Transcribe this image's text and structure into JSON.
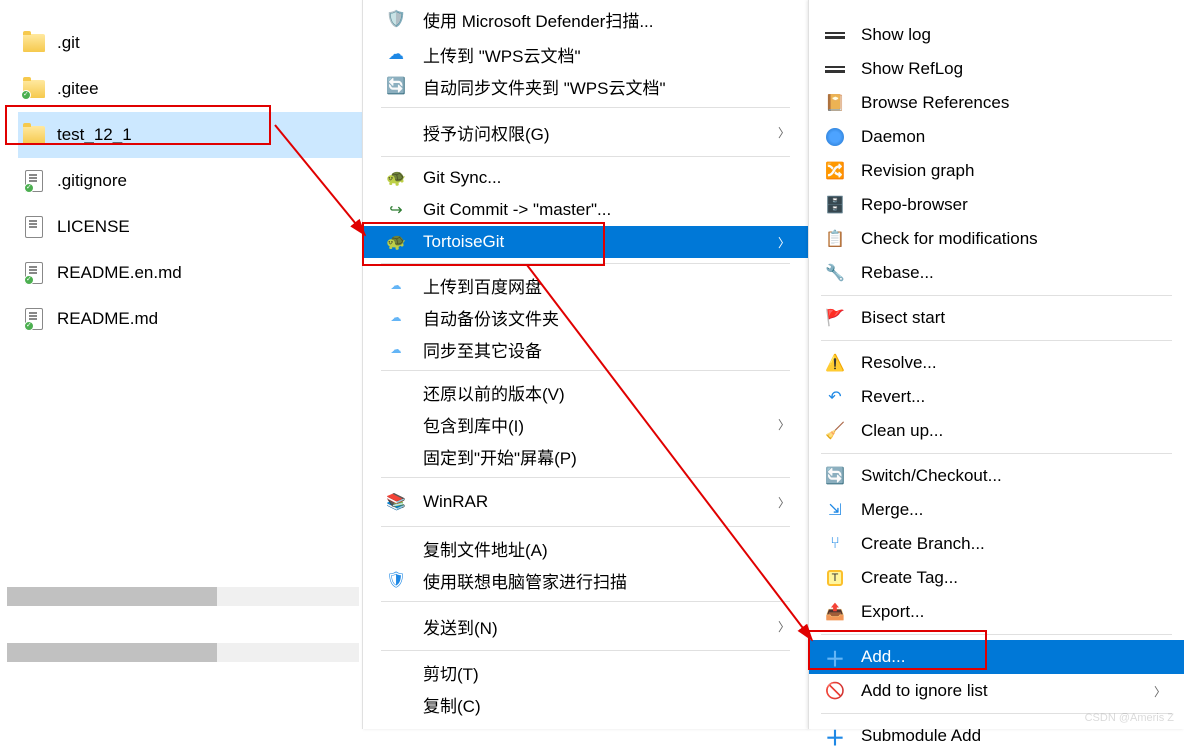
{
  "files": [
    {
      "name": ".git",
      "type": "folder",
      "checked": false
    },
    {
      "name": ".gitee",
      "type": "folder",
      "checked": true
    },
    {
      "name": "test_12_1",
      "type": "folder",
      "checked": false,
      "selected": true
    },
    {
      "name": ".gitignore",
      "type": "file",
      "checked": true
    },
    {
      "name": "LICENSE",
      "type": "file",
      "checked": false
    },
    {
      "name": "README.en.md",
      "type": "file",
      "checked": true
    },
    {
      "name": "README.md",
      "type": "file",
      "checked": true
    }
  ],
  "context_menu": {
    "defender": "使用 Microsoft Defender扫描...",
    "wps_upload": "上传到 \"WPS云文档\"",
    "wps_sync": "自动同步文件夹到 \"WPS云文档\"",
    "grant_access": "授予访问权限(G)",
    "git_sync": "Git Sync...",
    "git_commit": "Git Commit -> \"master\"...",
    "tortoisegit": "TortoiseGit",
    "baidu_upload": "上传到百度网盘",
    "baidu_backup": "自动备份该文件夹",
    "baidu_sync": "同步至其它设备",
    "restore": "还原以前的版本(V)",
    "include": "包含到库中(I)",
    "pin_start": "固定到\"开始\"屏幕(P)",
    "winrar": "WinRAR",
    "copy_addr": "复制文件地址(A)",
    "lenovo_scan": "使用联想电脑管家进行扫描",
    "send_to": "发送到(N)",
    "cut": "剪切(T)",
    "copy": "复制(C)"
  },
  "submenu": {
    "show_log": "Show log",
    "show_reflog": "Show RefLog",
    "browse_ref": "Browse References",
    "daemon": "Daemon",
    "revision_graph": "Revision graph",
    "repo_browser": "Repo-browser",
    "check_mod": "Check for modifications",
    "rebase": "Rebase...",
    "bisect": "Bisect start",
    "resolve": "Resolve...",
    "revert": "Revert...",
    "cleanup": "Clean up...",
    "switch": "Switch/Checkout...",
    "merge": "Merge...",
    "create_branch": "Create Branch...",
    "create_tag": "Create Tag...",
    "export": "Export...",
    "add": "Add...",
    "add_ignore": "Add to ignore list",
    "submodule_add": "Submodule Add"
  },
  "watermark": "CSDN @Ameris Z"
}
